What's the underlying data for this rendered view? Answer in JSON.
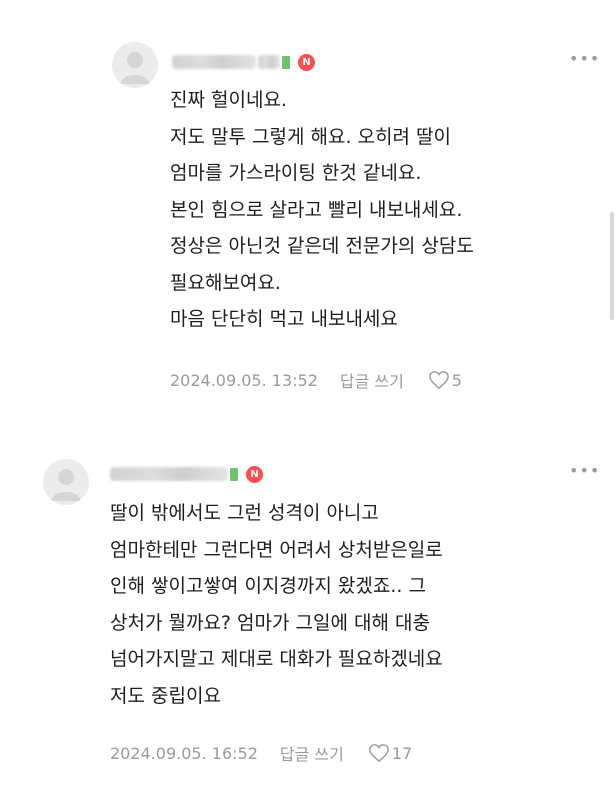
{
  "comments": [
    {
      "author": "",
      "badge": "N",
      "more_icon": "more-dots-icon",
      "lines": [
        "진짜 헐이네요.",
        "저도 말투 그렇게 해요. 오히려 딸이",
        "엄마를 가스라이팅 한것 같네요.",
        "본인 힘으로 살라고 빨리 내보내세요.",
        "정상은 아닌것 같은데 전문가의 상담도",
        "필요해보여요.",
        "마음 단단히 먹고 내보내세요"
      ],
      "date": "2024.09.05. 13:52",
      "reply_label": "답글 쓰기",
      "likes": "5"
    },
    {
      "author": "",
      "badge": "N",
      "more_icon": "more-dots-icon",
      "lines": [
        "딸이 밖에서도 그런 성격이 아니고",
        "엄마한테만 그런다면 어려서 상처받은일로",
        "인해 쌓이고쌓여 이지경까지 왔겠죠.. 그",
        "상처가 뭘까요? 엄마가 그일에 대해 대충",
        "넘어가지말고 제대로 대화가 필요하겠네요",
        "저도 중립이요"
      ],
      "date": "2024.09.05. 16:52",
      "reply_label": "답글 쓰기",
      "likes": "17"
    }
  ],
  "colors": {
    "badge": "#ff4d4d",
    "meta": "#9a9a9a",
    "grade": "#6ec26e"
  }
}
